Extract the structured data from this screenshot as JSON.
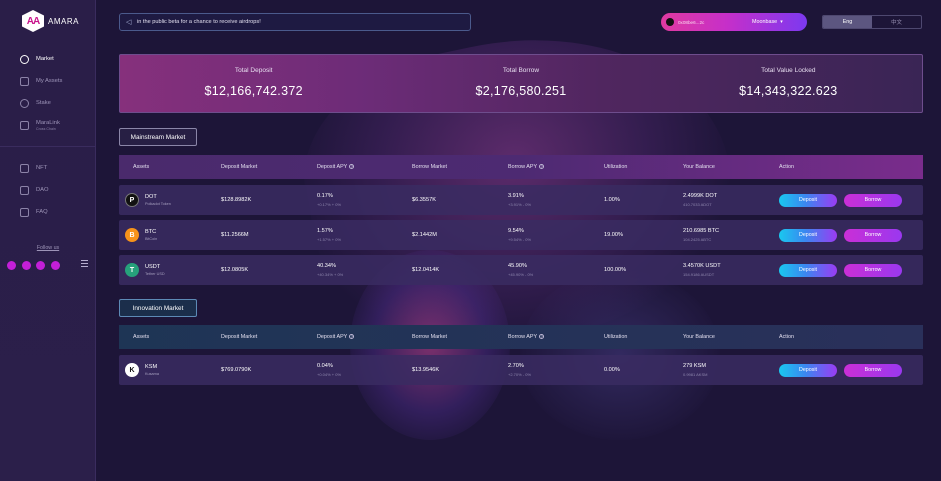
{
  "brand": {
    "name": "AMARA",
    "logo_glyph": "AA"
  },
  "sidebar": {
    "items": [
      {
        "label": "Market",
        "icon": "dollar-circle-icon",
        "active": true
      },
      {
        "label": "My Assets",
        "icon": "folder-icon",
        "active": false
      },
      {
        "label": "Stake",
        "icon": "stake-icon",
        "active": false
      },
      {
        "label": "MaraLink",
        "sub": "Cross Chain",
        "icon": "link-icon",
        "active": false
      },
      {
        "label": "NFT",
        "icon": "nft-icon",
        "active": false
      },
      {
        "label": "DAO",
        "icon": "dao-icon",
        "active": false
      },
      {
        "label": "FAQ",
        "icon": "faq-icon",
        "active": false
      }
    ],
    "follow_label": "Follow us",
    "socials": [
      "twitter-icon",
      "telegram-icon",
      "discord-icon",
      "medium-icon"
    ]
  },
  "announcement": {
    "text": "in the public beta for a chance to receive airdrops!",
    "icon": "speaker-icon"
  },
  "wallet": {
    "address": "0x08be6...2c",
    "network": "Moonbase",
    "chevron": "▾"
  },
  "language": {
    "options": [
      "Eng",
      "中文"
    ],
    "selected": "Eng"
  },
  "stats": [
    {
      "label": "Total Deposit",
      "value": "$12,166,742.372"
    },
    {
      "label": "Total Borrow",
      "value": "$2,176,580.251"
    },
    {
      "label": "Total Value Locked",
      "value": "$14,343,322.623"
    }
  ],
  "columns": [
    "Assets",
    "Deposit Market",
    "Deposit APY",
    "Borrow Market",
    "Borrow APY",
    "Utilization",
    "Your Balance",
    "Action"
  ],
  "mainstream": {
    "title": "Mainstream Market",
    "rows": [
      {
        "symbol": "DOT",
        "name": "Polkadot Token",
        "coin_glyph": "P",
        "deposit_market": "$128.8982K",
        "deposit_apy": "0.17%",
        "deposit_apy_sub": "+0.17% + 0%",
        "borrow_market": "$6.3557K",
        "borrow_apy": "3.91%",
        "borrow_apy_sub": "+3.91% - 0%",
        "utilization": "1.00%",
        "balance": "2.4999K DOT",
        "balance_sub": "410.7033 ADOT"
      },
      {
        "symbol": "BTC",
        "name": "BitCoin",
        "coin_glyph": "B",
        "deposit_market": "$11.2566M",
        "deposit_apy": "1.57%",
        "deposit_apy_sub": "+1.57% + 0%",
        "borrow_market": "$2.1442M",
        "borrow_apy": "9.54%",
        "borrow_apy_sub": "+9.54% - 0%",
        "utilization": "19.00%",
        "balance": "210.6985 BTC",
        "balance_sub": "104.2425 ABTC"
      },
      {
        "symbol": "USDT",
        "name": "Tether USD",
        "coin_glyph": "T",
        "deposit_market": "$12.0805K",
        "deposit_apy": "40.34%",
        "deposit_apy_sub": "+40.34% + 0%",
        "borrow_market": "$12.0414K",
        "borrow_apy": "45.90%",
        "borrow_apy_sub": "+45.90% - 0%",
        "utilization": "100.00%",
        "balance": "3.4570K USDT",
        "balance_sub": "154.9186 AUSDT"
      }
    ]
  },
  "innovation": {
    "title": "Innovation Market",
    "rows": [
      {
        "symbol": "KSM",
        "name": "Kusama",
        "coin_glyph": "K",
        "deposit_market": "$769.0790K",
        "deposit_apy": "0.04%",
        "deposit_apy_sub": "+0.04% + 0%",
        "borrow_market": "$13.9546K",
        "borrow_apy": "2.70%",
        "borrow_apy_sub": "+2.70% - 0%",
        "utilization": "0.00%",
        "balance": "279 KSM",
        "balance_sub": "0.9981 AKSM"
      }
    ]
  },
  "buttons": {
    "deposit": "Deposit",
    "borrow": "Borrow"
  }
}
